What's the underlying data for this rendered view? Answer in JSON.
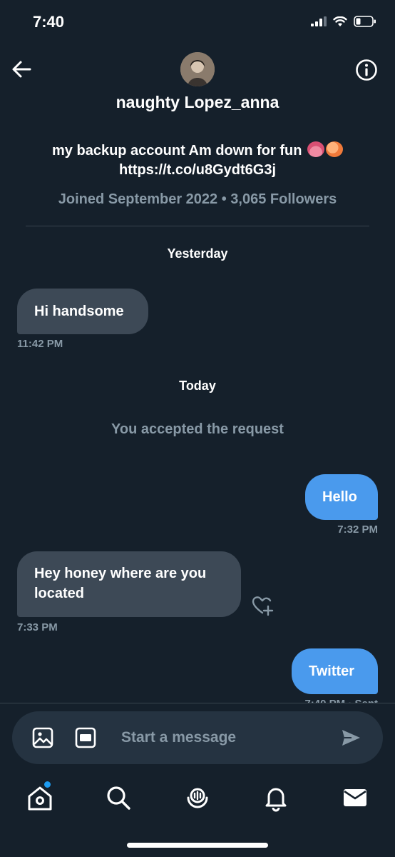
{
  "status_bar": {
    "time": "7:40"
  },
  "header": {
    "name": "naughty Lopez_anna",
    "bio_line1": "my backup account Am down for fun",
    "bio_link": "https://t.co/u8Gydt6G3j",
    "joined": "Joined September 2022 • 3,065 Followers"
  },
  "conversation": {
    "day1": "Yesterday",
    "msg1": {
      "text": "Hi handsome",
      "time": "11:42 PM"
    },
    "day2": "Today",
    "system": "You accepted the request",
    "msg2": {
      "text": "Hello",
      "time": "7:32 PM"
    },
    "msg3": {
      "line1": "Hey honey where are you",
      "line2": "located",
      "time": "7:33 PM"
    },
    "msg4": {
      "text": "Twitter",
      "status": "7:40 PM · Sent"
    }
  },
  "composer": {
    "placeholder": "Start a message",
    "gif_label": "GIF"
  },
  "colors": {
    "background": "#15202b",
    "incoming_bubble": "#3d4956",
    "outgoing_bubble": "#4a9aed",
    "muted_text": "#8899a6",
    "notification_dot": "#1d9bf0"
  },
  "icons": [
    "back-arrow-icon",
    "info-icon",
    "image-icon",
    "gif-icon",
    "send-icon",
    "home-icon",
    "search-icon",
    "spaces-icon",
    "bell-icon",
    "mail-icon",
    "heart-plus-icon"
  ]
}
